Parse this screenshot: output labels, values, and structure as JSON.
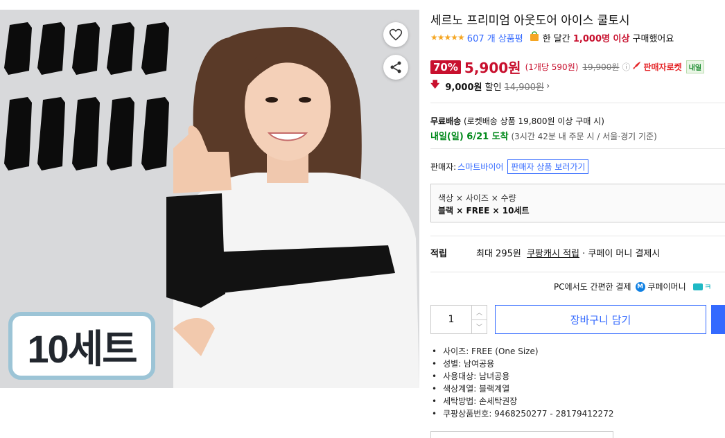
{
  "product": {
    "title": "세르노 프리미엄 아웃도어 아이스 쿨토시",
    "set_badge": "10세트",
    "rating_stars": "★★★★★",
    "review_count_text": "607 개 상품평",
    "bought_prefix": "한 달간",
    "bought_count": "1,000명 이상",
    "bought_suffix": "구매했어요"
  },
  "price": {
    "discount_rate": "70%",
    "sale_price": "5,900원",
    "unit_price": "(1개당 590원)",
    "original_price": "19,900원",
    "info_icon": "ⓘ",
    "rocket_label": "판매자로켓",
    "tomorrow_badge": "내일",
    "coupon_amount": "9,000원",
    "coupon_label": "할인",
    "coupon_original": "14,900원",
    "chevron": "›"
  },
  "shipping": {
    "free_label": "무료배송",
    "free_note": "(로켓배송 상품 19,800원 이상 구매 시)",
    "arrival": "내일(일) 6/21 도착",
    "arrival_note": "(3시간 42분 내 주문 시 / 서울⋅경기 기준)"
  },
  "seller": {
    "label": "판매자:",
    "name": "스마트바이어",
    "goods_button": "판매자 상품 보러가기"
  },
  "options": {
    "labels": "색상 × 사이즈 × 수량",
    "values": "블랙 × FREE × 10세트"
  },
  "reward": {
    "title": "적립",
    "prefix": "최대 295원",
    "cash_link": "쿠팡캐시 적립",
    "suffix": "· 쿠페이 머니 결제시"
  },
  "payment": {
    "easy_pay_text": "PC에서도 간편한 결제",
    "m_icon": "M",
    "coupay_money": "쿠페이머니",
    "more": "ㅋ"
  },
  "cart": {
    "quantity": "1",
    "plus": "︿",
    "minus": "﹀",
    "add_to_cart": "장바구니 담기"
  },
  "attributes": [
    "사이즈: FREE (One Size)",
    "성별: 남여공용",
    "사용대상: 남녀공용",
    "색상계열: 블랙계열",
    "세탁방법: 손세탁권장",
    "쿠팡상품번호: 9468250277 - 28179412272"
  ],
  "colors": {
    "accent_blue": "#346aff",
    "sale_red": "#c8102e",
    "arrival_green": "#00891a"
  },
  "icons": {
    "wishlist": "heart-icon",
    "share": "share-icon",
    "rocket": "rocket-icon",
    "shopping_bag": "shopping-bag-icon",
    "discount_arrow": "arrow-down-icon"
  }
}
